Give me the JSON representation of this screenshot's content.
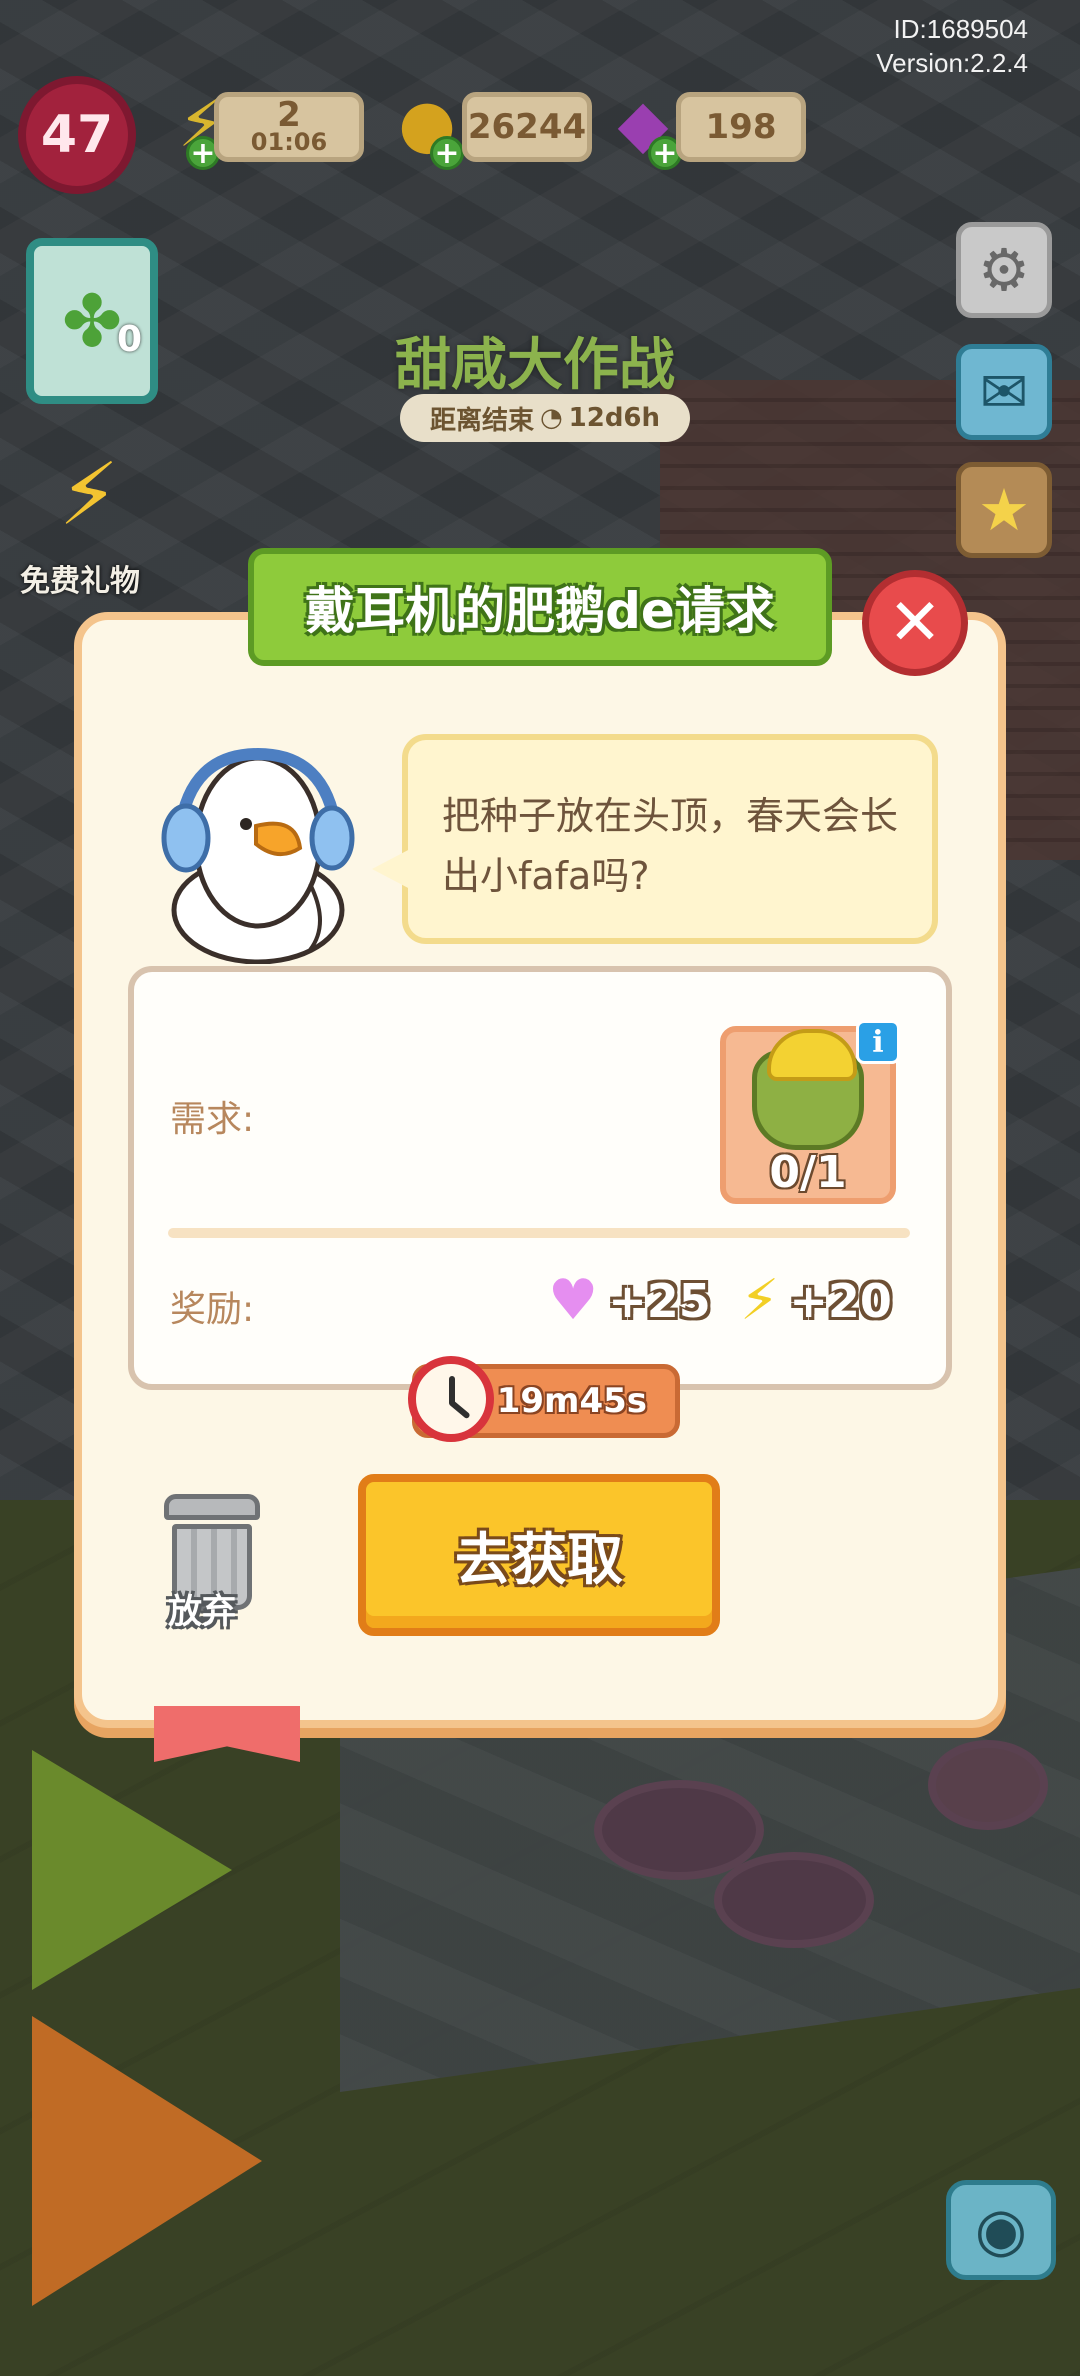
{
  "hud": {
    "id_text": "ID:1689504",
    "version_text": "Version:2.2.4",
    "level": "47",
    "energy": {
      "value": "2",
      "timer": "01:06",
      "icon": "lightning-icon"
    },
    "coins": {
      "value": "26244",
      "icon": "coin-icon"
    },
    "gems": {
      "value": "198",
      "icon": "gem-icon"
    },
    "side_card_badge": "0"
  },
  "side": {
    "gift_label": "免费礼物"
  },
  "event": {
    "title": "甜咸大作战",
    "countdown_label": "距离结束",
    "countdown_value": "12d6h"
  },
  "dialog": {
    "title": "戴耳机的肥鹅de请求",
    "speech": "把种子放在头顶，春天会长出小fafa吗?",
    "requirement_label": "需求:",
    "reward_label": "奖励:",
    "item": {
      "name": "seed-sack",
      "count": "0/1"
    },
    "rewards": [
      {
        "icon": "heart-icon",
        "value": "+25"
      },
      {
        "icon": "lightning-icon",
        "value": "+20"
      }
    ],
    "timer": "19m45s",
    "abandon_label": "放弃",
    "go_label": "去获取"
  },
  "colors": {
    "ribbon_green": "#8ecb3b",
    "dialog_bg": "#fdf7e6",
    "button_yellow": "#fbc52a",
    "close_red": "#e84b4c"
  }
}
